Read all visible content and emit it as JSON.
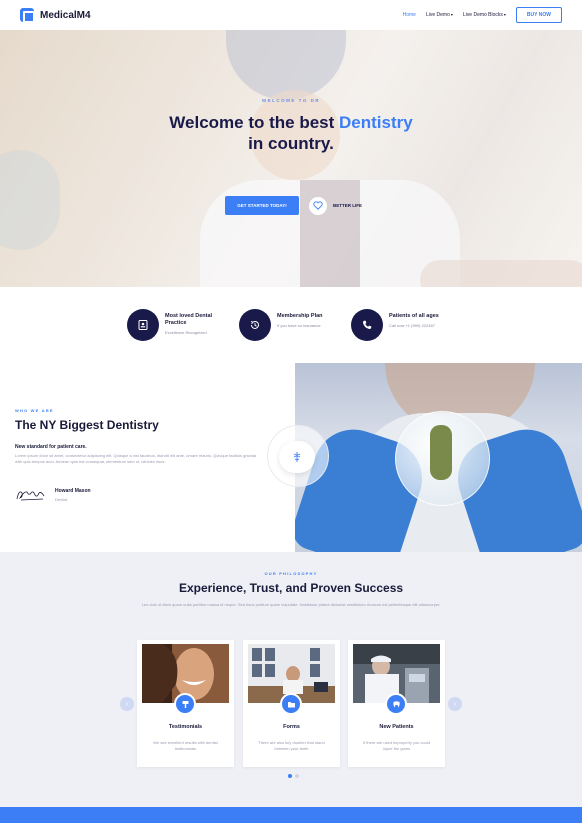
{
  "brand": {
    "name": "MedicalM4",
    "accent": "#3b7ef5",
    "navy": "#1a1a4a"
  },
  "nav": {
    "items": [
      {
        "label": "Home",
        "active": true
      },
      {
        "label": "Live Demo",
        "caret": "▾"
      },
      {
        "label": "Live Demo Blocks",
        "caret": "▾"
      }
    ],
    "buy": "BUY NOW"
  },
  "hero": {
    "kicker": "WELCOME TO DR",
    "title_line1": "Welcome to the best ",
    "title_accent": "Dentistry",
    "title_line2": "in country.",
    "cta": "GET STARTED TODAY!",
    "secondary": "BETTER LIFE"
  },
  "features": [
    {
      "title": "Most loved Dental Practice",
      "desc": "Excellence Recognized",
      "icon": "badge-icon"
    },
    {
      "title": "Membership Plan",
      "desc": "If you have no insurance",
      "icon": "history-icon"
    },
    {
      "title": "Patients of all ages",
      "desc": "Call now +1 (999) 222487",
      "icon": "phone-icon"
    }
  ],
  "about": {
    "kicker": "WHO WE ARE",
    "title": "The NY Biggest Dentistry",
    "lead": "New standard for patient care.",
    "body": "Lorem ipsum dolor sit amet, consectetur adipiscing elit. Quisque a nisl faucibus, blandit elit ante, ornare mauris. Quisque facilisis gravida with quis tempus arcu. Aenean quis est consequat, elementum sem ut, ultricies risus.",
    "person_name": "Howard Mason",
    "person_role": "Dentist"
  },
  "philosophy": {
    "kicker": "OUR PHILOSOPHY",
    "title": "Experience, Trust, and Proven Success",
    "body": "Leo duis ut diam quam nulla porttitor massa id neque. Sed risus pretium quam vulputate. Habitasse platea dictumst vestibulum rhoncus est pellentesque elit ullamcorper.",
    "cards": [
      {
        "title": "Testimonials",
        "desc": "We see excellent results with dentist testimonials",
        "icon": "brush-icon"
      },
      {
        "title": "Forms",
        "desc": "There are also key doubter that stand between your teeth",
        "icon": "folder-icon"
      },
      {
        "title": "New Patients",
        "desc": "If there are used improperly you could injure the gums",
        "icon": "tooth-icon"
      }
    ],
    "prev_arrow": "‹",
    "next_arrow": "›"
  }
}
